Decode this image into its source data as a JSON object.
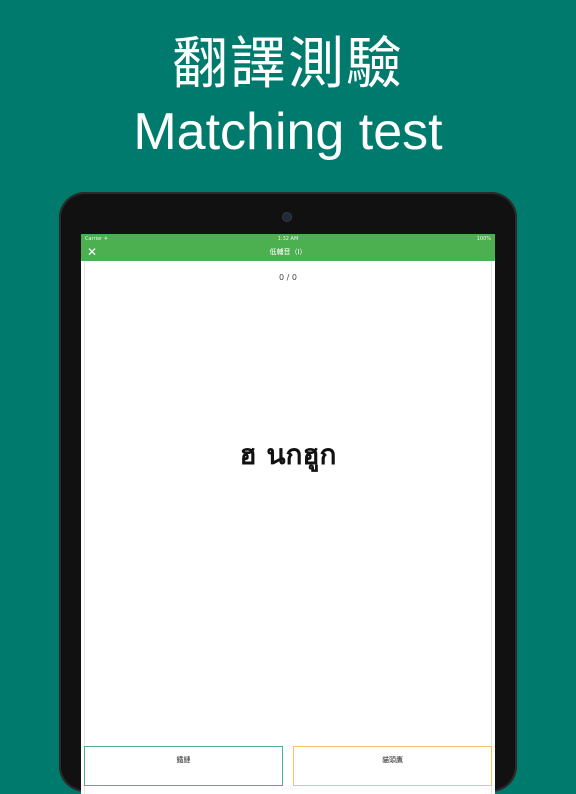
{
  "promo": {
    "title_zh": "翻譯測驗",
    "title_en": "Matching test"
  },
  "status_bar": {
    "carrier": "Carrier ✈",
    "time": "1:32 AM",
    "battery": "100%"
  },
  "nav": {
    "close": "✕",
    "title": "低輔音（I）"
  },
  "quiz": {
    "progress": "0 / 0",
    "question": "ฮ นกฮูก"
  },
  "answers": [
    {
      "label": "鐵鏈"
    },
    {
      "label": "貓頭鷹"
    }
  ],
  "colors": {
    "background": "#007a6c",
    "header": "#4caf50",
    "answer_left_border": "#4caf87",
    "answer_right_border": "#f0c26a"
  }
}
